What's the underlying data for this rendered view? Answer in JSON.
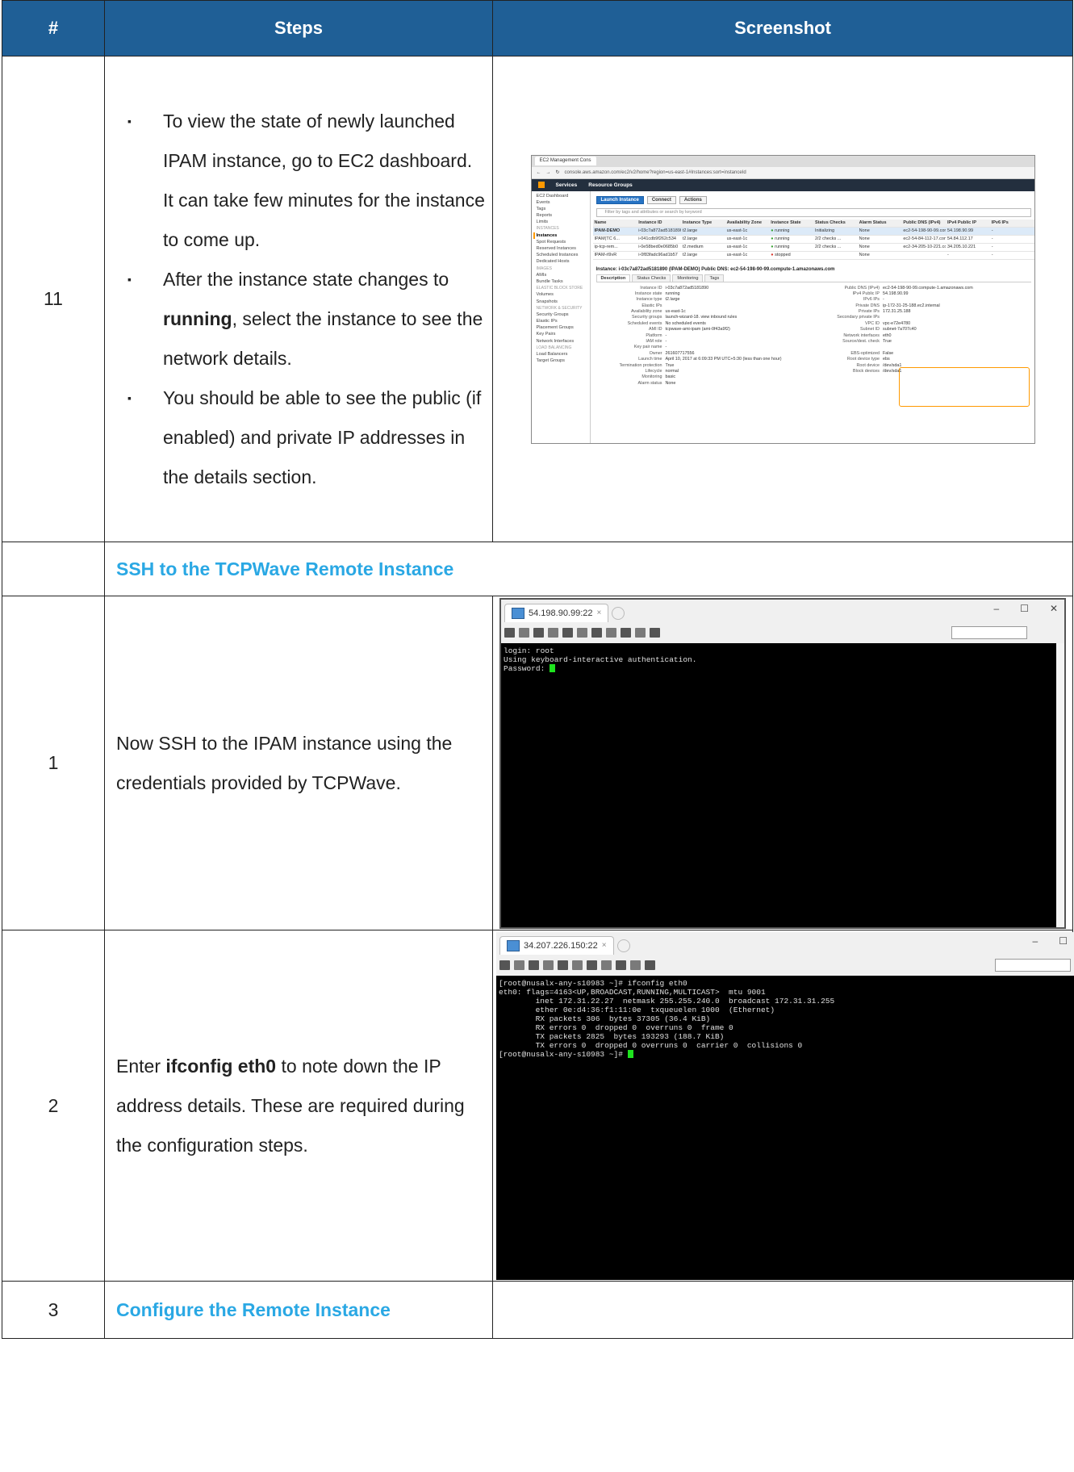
{
  "header": {
    "num": "#",
    "steps": "Steps",
    "screenshot": "Screenshot"
  },
  "row11": {
    "num": "11",
    "bullets": [
      "To view the state of newly launched IPAM instance, go to EC2 dashboard. It can take few minutes for the instance to come up.",
      {
        "pre": "After the instance state changes to ",
        "bold": "running",
        "post": ", select the instance to see the network details."
      },
      "You should be able to see the public (if enabled) and private IP addresses in the details section."
    ],
    "bullet_char": "▪"
  },
  "section1": "SSH to the TCPWave Remote Instance",
  "row1": {
    "num": "1",
    "text": "Now SSH to the IPAM instance using the credentials provided by TCPWave."
  },
  "row2": {
    "num": "2",
    "pre": "Enter ",
    "bold": "ifconfig eth0",
    "post": " to note down the IP address details. These are required during the configuration steps."
  },
  "row3": {
    "num": "3",
    "title": "Configure the Remote Instance"
  },
  "aws": {
    "tab": "EC2 Management Cons",
    "url": "console.aws.amazon.com/ec2/v2/home?region=us-east-1#Instances:sort=instanceId",
    "nav": [
      "Services",
      "Resource Groups"
    ],
    "side": [
      {
        "t": "EC2 Dashboard"
      },
      {
        "t": "Events"
      },
      {
        "t": "Tags"
      },
      {
        "t": "Reports"
      },
      {
        "t": "Limits"
      },
      {
        "t": "INSTANCES",
        "g": true
      },
      {
        "t": "Instances",
        "a": true
      },
      {
        "t": "Spot Requests"
      },
      {
        "t": "Reserved Instances"
      },
      {
        "t": "Scheduled Instances"
      },
      {
        "t": "Dedicated Hosts"
      },
      {
        "t": "IMAGES",
        "g": true
      },
      {
        "t": "AMIs"
      },
      {
        "t": "Bundle Tasks"
      },
      {
        "t": "ELASTIC BLOCK STORE",
        "g": true
      },
      {
        "t": "Volumes"
      },
      {
        "t": "Snapshots"
      },
      {
        "t": "NETWORK & SECURITY",
        "g": true
      },
      {
        "t": "Security Groups"
      },
      {
        "t": "Elastic IPs"
      },
      {
        "t": "Placement Groups"
      },
      {
        "t": "Key Pairs"
      },
      {
        "t": "Network Interfaces"
      },
      {
        "t": "LOAD BALANCING",
        "g": true
      },
      {
        "t": "Load Balancers"
      },
      {
        "t": "Target Groups"
      }
    ],
    "buttons": [
      "Launch Instance",
      "Connect",
      "Actions"
    ],
    "filter": "Filter by tags and attributes or search by keyword",
    "columns": [
      "Name",
      "Instance ID",
      "Instance Type",
      "Availability Zone",
      "Instance State",
      "Status Checks",
      "Alarm Status",
      "Public DNS (IPv4)",
      "IPv4 Public IP",
      "IPv6 IPs"
    ],
    "rows": [
      [
        "IPAM-DEMO",
        "i-03c7a872ad5181890",
        "t2.large",
        "us-east-1c",
        "running",
        "Initializing",
        "None",
        "ec2-54-198-90-99.com...",
        "54.198.90.99",
        "-"
      ],
      [
        "IPAM(TC 6...",
        "i-041cdb9f262c534",
        "t2.large",
        "us-east-1c",
        "running",
        "2/2 checks ...",
        "None",
        "ec2-54-84-112-17.com...",
        "54.84.112.17",
        "-"
      ],
      [
        "ip-tcp-rem...",
        "i-0e58bed0e0685b0",
        "t2.medium",
        "us-east-1c",
        "running",
        "2/2 checks ...",
        "None",
        "ec2-34-205-10-221.co...",
        "34.205.10.221",
        "-"
      ],
      [
        "IPAM-rl9vR",
        "i-0f83fadc96ad1b57",
        "t2.large",
        "us-east-1c",
        "stopped",
        "",
        "None",
        "",
        "-",
        "-"
      ]
    ],
    "detail_title": "Instance: i-03c7a872ad5181890 (IPAM-DEMO)    Public DNS: ec2-54-198-90-99.compute-1.amazonaws.com",
    "detail_tabs": [
      "Description",
      "Status Checks",
      "Monitoring",
      "Tags"
    ],
    "left_fields": [
      [
        "Instance ID",
        "i-03c7a872ad5181890"
      ],
      [
        "Instance state",
        "running"
      ],
      [
        "Instance type",
        "t2.large"
      ],
      [
        "Elastic IPs",
        ""
      ],
      [
        "Availability zone",
        "us-east-1c"
      ],
      [
        "Security groups",
        "launch-wizard-18. view inbound rules"
      ],
      [
        "Scheduled events",
        "No scheduled events"
      ],
      [
        "AMI ID",
        "tcpwave-ami-ipam (ami-0f43a9f2)"
      ],
      [
        "Platform",
        "-"
      ],
      [
        "IAM role",
        "-"
      ],
      [
        "Key pair name",
        "-"
      ],
      [
        "Owner",
        "261607717556"
      ],
      [
        "Launch time",
        "April 10, 2017 at 6:09:33 PM UTC+5:30 (less than one hour)"
      ],
      [
        "Termination protection",
        "True"
      ],
      [
        "Lifecycle",
        "normal"
      ],
      [
        "Monitoring",
        "basic"
      ],
      [
        "Alarm status",
        "None"
      ]
    ],
    "right_fields": [
      [
        "Public DNS (IPv4)",
        "ec2-54-198-90-99.compute-1.amazonaws.com"
      ],
      [
        "IPv4 Public IP",
        "54.198.90.99"
      ],
      [
        "IPv6 IPs",
        "-"
      ],
      [
        "Private DNS",
        "ip-172-31-25-188.ec2.internal"
      ],
      [
        "Private IPs",
        "172.31.25.188"
      ],
      [
        "Secondary private IPs",
        ""
      ],
      [
        "VPC ID",
        "vpc-e72e4780"
      ],
      [
        "Subnet ID",
        "subnet-7a707c40"
      ],
      [
        "Network interfaces",
        "eth0"
      ],
      [
        "Source/dest. check",
        "True"
      ],
      [
        "",
        ""
      ],
      [
        "EBS-optimized",
        "False"
      ],
      [
        "Root device type",
        "ebs"
      ],
      [
        "Root device",
        "/dev/sda1"
      ],
      [
        "Block devices",
        "/dev/sda1"
      ]
    ]
  },
  "term1": {
    "tab": "54.198.90.99:22",
    "lines": [
      "login: root",
      "Using keyboard-interactive authentication.",
      "Password: "
    ]
  },
  "term2": {
    "tab": "34.207.226.150:22",
    "lines": [
      "[root@nusalx-any-s10983 ~]# ifconfig eth0",
      "eth0: flags=4163<UP,BROADCAST,RUNNING,MULTICAST>  mtu 9001",
      "        inet 172.31.22.27  netmask 255.255.240.0  broadcast 172.31.31.255",
      "        ether 0e:d4:36:f1:11:0e  txqueuelen 1000  (Ethernet)",
      "        RX packets 306  bytes 37305 (36.4 KiB)",
      "        RX errors 0  dropped 0  overruns 0  frame 0",
      "        TX packets 2825  bytes 193293 (188.7 KiB)",
      "        TX errors 0  dropped 0 overruns 0  carrier 0  collisions 0",
      "",
      "[root@nusalx-any-s10983 ~]# "
    ]
  },
  "colors": {
    "header_bg": "#1f5f96",
    "section_title": "#2aa8e4",
    "cursor": "#1ee31e"
  }
}
